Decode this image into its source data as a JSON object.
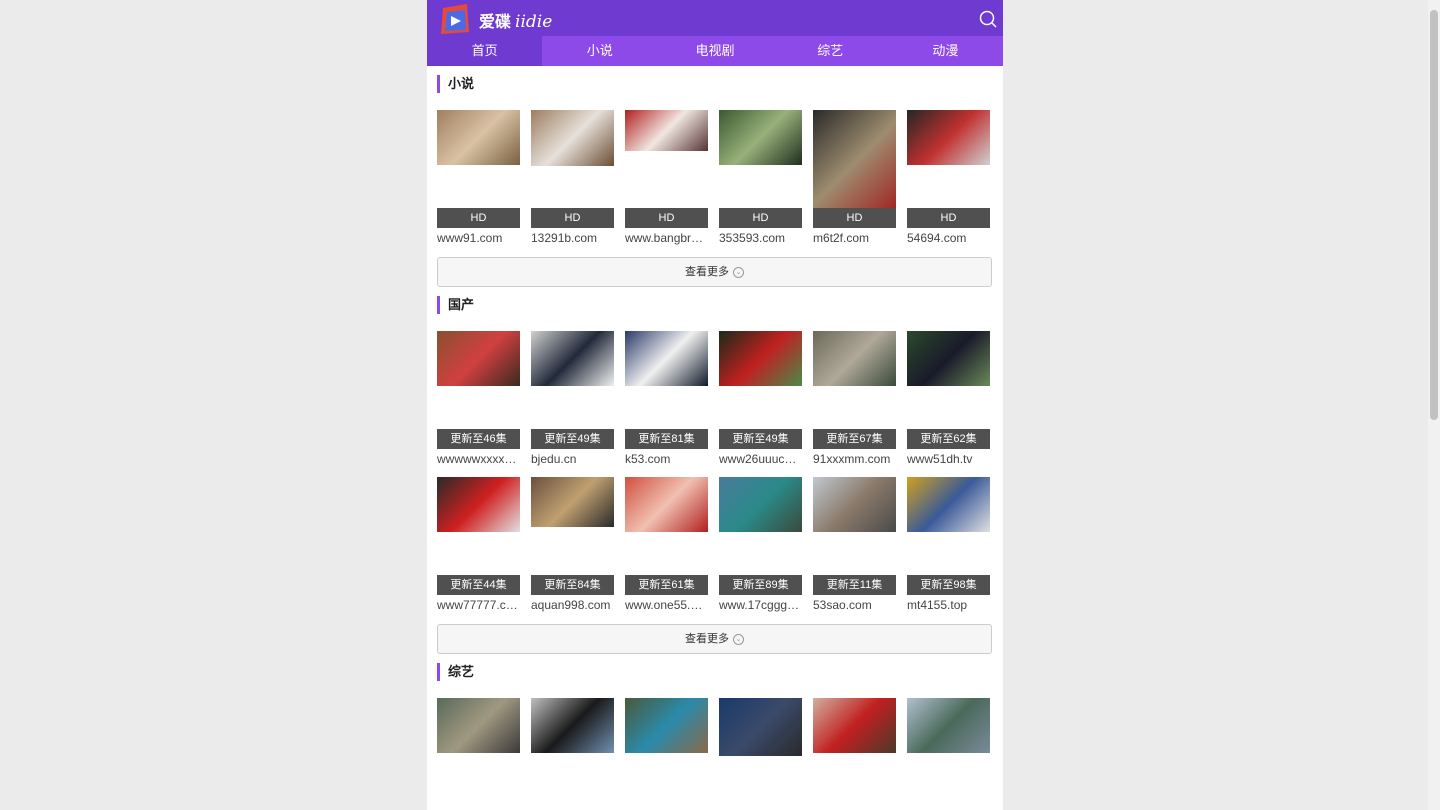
{
  "brand": {
    "cn": "爱碟",
    "en": "iidie"
  },
  "nav": [
    "首页",
    "小说",
    "电视剧",
    "综艺",
    "动漫"
  ],
  "more_label": "查看更多",
  "sections": [
    {
      "title": "小说",
      "items": [
        {
          "badge": "HD",
          "caption": "www91.com",
          "h": 55,
          "colors": [
            "#a08060",
            "#d9c2a4",
            "#786040"
          ]
        },
        {
          "badge": "HD",
          "caption": "13291b.com",
          "h": 56,
          "colors": [
            "#9d7d60",
            "#e6e0da",
            "#6b4e34"
          ]
        },
        {
          "badge": "HD",
          "caption": "www.bangbr…",
          "h": 41,
          "colors": [
            "#b02020",
            "#f0e6e0",
            "#553333"
          ]
        },
        {
          "badge": "HD",
          "caption": "353593.com",
          "h": 55,
          "colors": [
            "#3a5a30",
            "#99b07a",
            "#1f2f1f"
          ]
        },
        {
          "badge": "HD",
          "caption": "m6t2f.com",
          "h": 105,
          "colors": [
            "#2a2a2a",
            "#9d8c6e",
            "#a02020"
          ]
        },
        {
          "badge": "HD",
          "caption": "54694.com",
          "h": 55,
          "colors": [
            "#262626",
            "#c03030",
            "#d0d0d0"
          ]
        }
      ]
    },
    {
      "title": "国产",
      "items": [
        {
          "badge": "更新至46集",
          "caption": "wwwwwxxxx…",
          "h": 55,
          "colors": [
            "#8a5030",
            "#d04040",
            "#3a2a20"
          ]
        },
        {
          "badge": "更新至49集",
          "caption": "bjedu.cn",
          "h": 55,
          "colors": [
            "#d0d0d0",
            "#222a3a",
            "#f0f0f0"
          ]
        },
        {
          "badge": "更新至81集",
          "caption": "k53.com",
          "h": 55,
          "colors": [
            "#2a3a6a",
            "#f0f0f0",
            "#111a2a"
          ]
        },
        {
          "badge": "更新至49集",
          "caption": "www26uuuc…",
          "h": 55,
          "colors": [
            "#1a2a1a",
            "#c02020",
            "#4a8a4a"
          ]
        },
        {
          "badge": "更新至67集",
          "caption": "91xxxmm.com",
          "h": 55,
          "colors": [
            "#6a6a5a",
            "#b0a898",
            "#3a4a3a"
          ]
        },
        {
          "badge": "更新至62集",
          "caption": "www51dh.tv",
          "h": 55,
          "colors": [
            "#2a4a2a",
            "#1a1a2a",
            "#6a8a5a"
          ]
        },
        {
          "badge": "更新至44集",
          "caption": "www77777.c…",
          "h": 55,
          "colors": [
            "#2a2a2a",
            "#d02020",
            "#e0e0e0"
          ]
        },
        {
          "badge": "更新至84集",
          "caption": "aquan998.com",
          "h": 50,
          "colors": [
            "#6a5040",
            "#c0a070",
            "#2a2a2a"
          ]
        },
        {
          "badge": "更新至61集",
          "caption": "www.one55.…",
          "h": 55,
          "colors": [
            "#d05040",
            "#f0c0b0",
            "#b02020"
          ]
        },
        {
          "badge": "更新至89集",
          "caption": "www.17cggg…",
          "h": 55,
          "colors": [
            "#4a7a9a",
            "#2a8a8a",
            "#3a4a3a"
          ]
        },
        {
          "badge": "更新至11集",
          "caption": "53sao.com",
          "h": 55,
          "colors": [
            "#c0c8d0",
            "#8a7a6a",
            "#4a4a4a"
          ]
        },
        {
          "badge": "更新至98集",
          "caption": "mt4155.top",
          "h": 55,
          "colors": [
            "#d0a020",
            "#3a5a9a",
            "#e0e0e0"
          ]
        }
      ]
    },
    {
      "title": "综艺",
      "items": [
        {
          "badge": "",
          "caption": "",
          "h": 55,
          "colors": [
            "#5a6a5a",
            "#a09880",
            "#3a3a3a"
          ]
        },
        {
          "badge": "",
          "caption": "",
          "h": 55,
          "colors": [
            "#c0c0c0",
            "#1a1a1a",
            "#7090b0"
          ]
        },
        {
          "badge": "",
          "caption": "",
          "h": 55,
          "colors": [
            "#4a5a3a",
            "#2a8aaa",
            "#8a6a4a"
          ]
        },
        {
          "badge": "",
          "caption": "",
          "h": 58,
          "colors": [
            "#1a3a6a",
            "#3a4a6a",
            "#2a2a2a"
          ]
        },
        {
          "badge": "",
          "caption": "",
          "h": 55,
          "colors": [
            "#d0b0a0",
            "#c02020",
            "#4a3a2a"
          ]
        },
        {
          "badge": "",
          "caption": "",
          "h": 55,
          "colors": [
            "#b0c0d0",
            "#4a6a5a",
            "#7a8a9a"
          ]
        }
      ]
    }
  ]
}
